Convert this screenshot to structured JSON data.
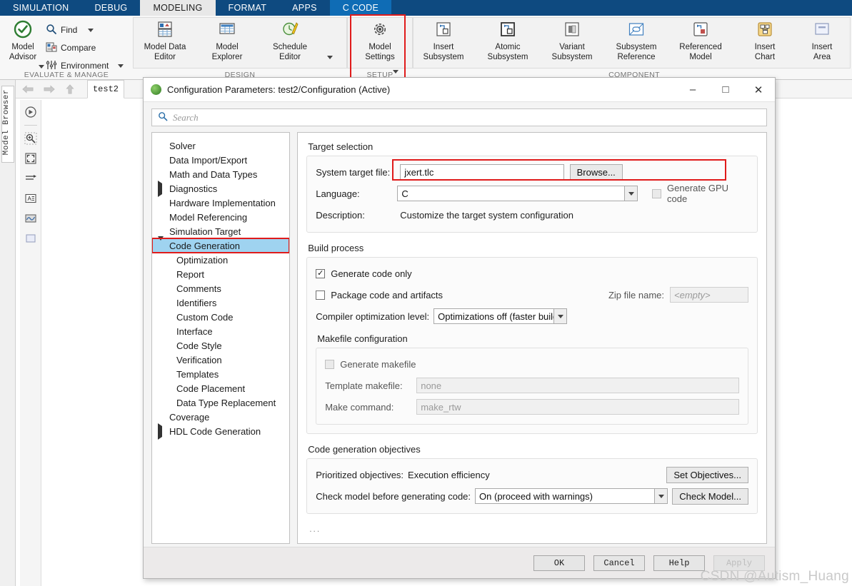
{
  "ribbon": {
    "tabs": [
      {
        "label": "SIMULATION",
        "state": "normal"
      },
      {
        "label": "DEBUG",
        "state": "normal"
      },
      {
        "label": "MODELING",
        "state": "active"
      },
      {
        "label": "FORMAT",
        "state": "normal"
      },
      {
        "label": "APPS",
        "state": "normal"
      },
      {
        "label": "C CODE",
        "state": "accent"
      }
    ],
    "groups": [
      {
        "label": "EVALUATE & MANAGE"
      },
      {
        "label": "DESIGN"
      },
      {
        "label": "SETUP"
      },
      {
        "label": "COMPONENT"
      }
    ],
    "model_advisor": "Model\nAdvisor",
    "small_items": [
      {
        "label": "Find",
        "icon": "search-icon",
        "has_caret": true
      },
      {
        "label": "Compare",
        "icon": "compare-icon",
        "has_caret": false
      },
      {
        "label": "Environment",
        "icon": "sliders-icon",
        "has_caret": true
      }
    ],
    "buttons": [
      {
        "label": "Model Data\nEditor",
        "icon": "model-data-editor-icon"
      },
      {
        "label": "Model\nExplorer",
        "icon": "model-explorer-icon"
      },
      {
        "label": "Schedule\nEditor",
        "icon": "schedule-editor-icon"
      },
      {
        "label": "Model\nSettings",
        "icon": "gear-icon",
        "highlighted": true,
        "has_caret": true
      },
      {
        "label": "Insert\nSubsystem",
        "icon": "insert-subsystem-icon"
      },
      {
        "label": "Atomic\nSubsystem",
        "icon": "atomic-subsystem-icon"
      },
      {
        "label": "Variant\nSubsystem",
        "icon": "variant-subsystem-icon"
      },
      {
        "label": "Subsystem\nReference",
        "icon": "subsystem-reference-icon"
      },
      {
        "label": "Referenced\nModel",
        "icon": "referenced-model-icon"
      },
      {
        "label": "Insert\nChart",
        "icon": "insert-chart-icon"
      },
      {
        "label": "Insert\nArea",
        "icon": "insert-area-icon"
      }
    ],
    "highlight_color": "#e01b1b"
  },
  "editor": {
    "model_browser_label": "Model Browser",
    "model_tab": "test2"
  },
  "dialog": {
    "title": "Configuration Parameters: test2/Configuration (Active)",
    "window_buttons": {
      "minimize": "–",
      "maximize": "□",
      "close": "✕"
    },
    "search": {
      "placeholder": "Search",
      "value": ""
    },
    "tree": [
      {
        "label": "Solver",
        "level": 0,
        "expander": "none",
        "selected": false
      },
      {
        "label": "Data Import/Export",
        "level": 0,
        "expander": "none",
        "selected": false
      },
      {
        "label": "Math and Data Types",
        "level": 0,
        "expander": "none",
        "selected": false
      },
      {
        "label": "Diagnostics",
        "level": 0,
        "expander": "collapsed",
        "selected": false
      },
      {
        "label": "Hardware Implementation",
        "level": 0,
        "expander": "none",
        "selected": false
      },
      {
        "label": "Model Referencing",
        "level": 0,
        "expander": "none",
        "selected": false
      },
      {
        "label": "Simulation Target",
        "level": 0,
        "expander": "none",
        "selected": false
      },
      {
        "label": "Code Generation",
        "level": 0,
        "expander": "expanded",
        "selected": true
      },
      {
        "label": "Optimization",
        "level": 1,
        "expander": "none",
        "selected": false
      },
      {
        "label": "Report",
        "level": 1,
        "expander": "none",
        "selected": false
      },
      {
        "label": "Comments",
        "level": 1,
        "expander": "none",
        "selected": false
      },
      {
        "label": "Identifiers",
        "level": 1,
        "expander": "none",
        "selected": false
      },
      {
        "label": "Custom Code",
        "level": 1,
        "expander": "none",
        "selected": false
      },
      {
        "label": "Interface",
        "level": 1,
        "expander": "none",
        "selected": false
      },
      {
        "label": "Code Style",
        "level": 1,
        "expander": "none",
        "selected": false
      },
      {
        "label": "Verification",
        "level": 1,
        "expander": "none",
        "selected": false
      },
      {
        "label": "Templates",
        "level": 1,
        "expander": "none",
        "selected": false
      },
      {
        "label": "Code Placement",
        "level": 1,
        "expander": "none",
        "selected": false
      },
      {
        "label": "Data Type Replacement",
        "level": 1,
        "expander": "none",
        "selected": false
      },
      {
        "label": "Coverage",
        "level": 0,
        "expander": "none",
        "selected": false
      },
      {
        "label": "HDL Code Generation",
        "level": 0,
        "expander": "collapsed",
        "selected": false
      }
    ],
    "target_selection": {
      "section_title": "Target selection",
      "system_target_file_label": "System target file:",
      "system_target_file_value": "jxert.tlc",
      "browse_label": "Browse...",
      "language_label": "Language:",
      "language_value": "C",
      "generate_gpu_label": "Generate GPU code",
      "generate_gpu_checked": false,
      "description_label": "Description:",
      "description_value": "Customize the target system configuration"
    },
    "build_process": {
      "section_title": "Build process",
      "generate_code_only_label": "Generate code only",
      "generate_code_only_checked": true,
      "package_code_label": "Package code and artifacts",
      "package_code_checked": false,
      "zip_file_label": "Zip file name:",
      "zip_file_value": "<empty>",
      "compiler_opt_label": "Compiler optimization level:",
      "compiler_opt_value": "Optimizations off (faster builds)",
      "makefile_title": "Makefile configuration",
      "generate_makefile_label": "Generate makefile",
      "generate_makefile_checked": false,
      "template_makefile_label": "Template makefile:",
      "template_makefile_value": "none",
      "make_command_label": "Make command:",
      "make_command_value": "make_rtw"
    },
    "objectives": {
      "section_title": "Code generation objectives",
      "prioritized_label": "Prioritized objectives:",
      "prioritized_value": "Execution efficiency",
      "set_objectives_label": "Set Objectives...",
      "check_model_label": "Check model before generating code:",
      "check_model_value": "On (proceed with warnings)",
      "check_model_button": "Check Model...",
      "more_dots": "..."
    },
    "footer": {
      "ok": "OK",
      "cancel": "Cancel",
      "help": "Help",
      "apply": "Apply"
    }
  },
  "watermark": "CSDN @Autism_Huang"
}
